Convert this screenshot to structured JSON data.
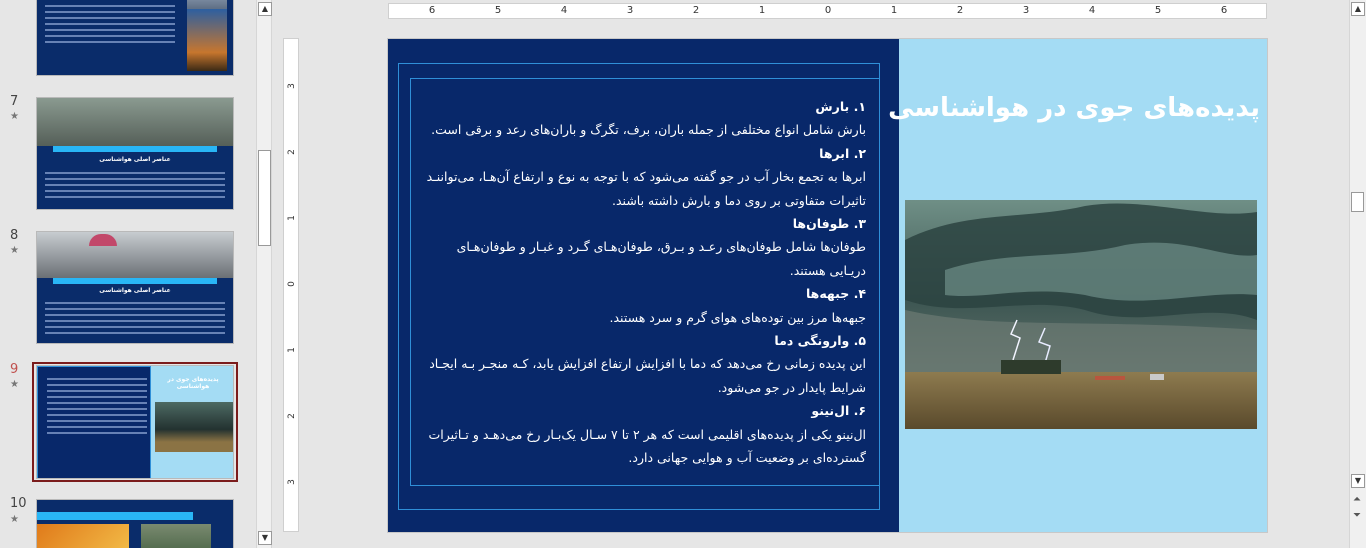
{
  "thumbnails": [
    {
      "number": "7",
      "title": "عناصر اصلی هواشناسی"
    },
    {
      "number": "8",
      "title": "عناصر اصلی هواشناسی"
    },
    {
      "number": "9",
      "title": "پدیده‌های جوی در هواشناسی"
    },
    {
      "number": "10",
      "title": ""
    }
  ],
  "ruler": {
    "h_labels": [
      "6",
      "5",
      "4",
      "3",
      "2",
      "1",
      "0",
      "1",
      "2",
      "3",
      "4",
      "5",
      "6"
    ],
    "v_labels": [
      "3",
      "2",
      "1",
      "0",
      "1",
      "2",
      "3"
    ]
  },
  "slide": {
    "title": "پدیده‌های جوی در هواشناسی",
    "paragraphs": [
      {
        "kind": "h",
        "text": "۱. بارش"
      },
      {
        "kind": "p",
        "text": "بارش شامل انواع مختلفی از جمله باران، برف، تگرگ و باران‌های رعد و برقی است."
      },
      {
        "kind": "h",
        "text": "۲. ابرها"
      },
      {
        "kind": "p",
        "text": "ابرها به تجمع بخار آب در جو گفته می‌شود که با توجه به نوع و ارتفاع آن‌هـا، می‌تواننـد تاثیرات متفاوتی بر روی دما و بارش داشته باشند."
      },
      {
        "kind": "h",
        "text": "۳. طوفان‌ها"
      },
      {
        "kind": "p",
        "text": "طوفان‌ها شامل طوفان‌های رعـد و بـرق، طوفان‌هـای گـرد و غبـار و طوفان‌هـای دریـایی هستند."
      },
      {
        "kind": "h",
        "text": "۴. جبهه‌ها"
      },
      {
        "kind": "p",
        "text": "جبهه‌ها مرز بین توده‌های هوای گرم و سرد هستند."
      },
      {
        "kind": "h",
        "text": "۵. وارونگی دما"
      },
      {
        "kind": "p",
        "text": "این پدیده زمانی رخ می‌دهد که دما با افزایش ارتفاع افزایش یابد، کـه منجـر بـه ایجـاد شرایط پایدار در جو می‌شود."
      },
      {
        "kind": "h",
        "text": "۶. ال‌نینو"
      },
      {
        "kind": "p",
        "text": "ال‌نینو یکی از پدیده‌های اقلیمی است که هر ۲ تا ۷ سـال یک‌بـار رخ می‌دهـد و تـاثیرات گسترده‌ای بر وضعیت آب و هوایی جهانی دارد."
      }
    ]
  },
  "colors": {
    "panel": "#08286a",
    "slide_bg": "#a4dcf4",
    "accent": "#29b6f6",
    "selection": "#7b1c1c"
  }
}
